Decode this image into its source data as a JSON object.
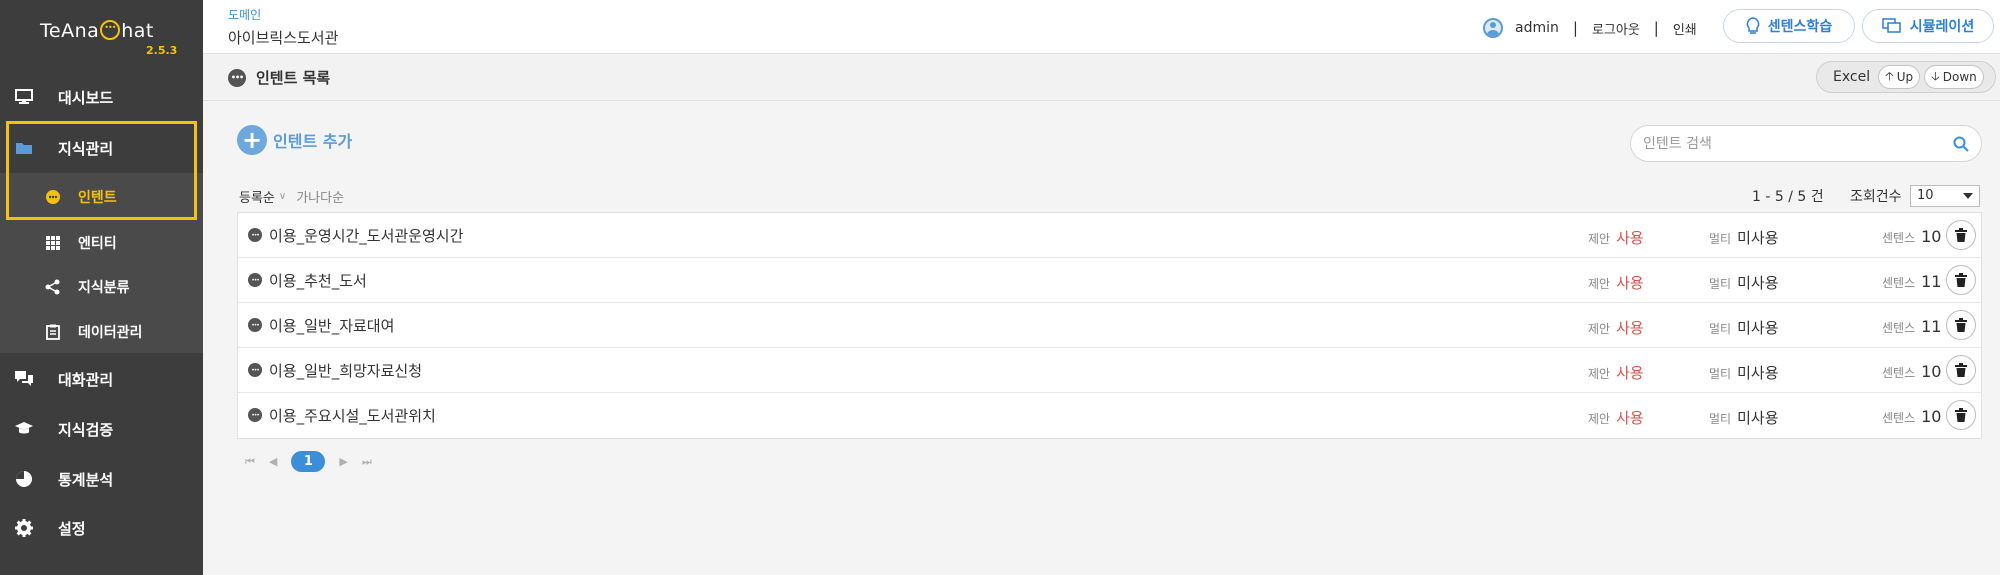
{
  "app": {
    "logo_text_before": "TeAna",
    "logo_text_after": "hat",
    "version": "2.5.3"
  },
  "sidebar": {
    "items": [
      {
        "label": "대시보드",
        "icon": "monitor-icon"
      },
      {
        "label": "지식관리",
        "icon": "folder-icon"
      },
      {
        "label": "대화관리",
        "icon": "chat-bubbles-icon"
      },
      {
        "label": "지식검증",
        "icon": "graduation-cap-icon"
      },
      {
        "label": "통계분석",
        "icon": "pie-chart-icon"
      },
      {
        "label": "설정",
        "icon": "gear-icon"
      }
    ],
    "sub_items": [
      {
        "label": "인텐트",
        "icon": "chat-bubble-icon",
        "active": true
      },
      {
        "label": "엔티티",
        "icon": "grid-icon"
      },
      {
        "label": "지식분류",
        "icon": "share-icon"
      },
      {
        "label": "데이터관리",
        "icon": "clipboard-icon"
      }
    ],
    "highlight_color": "#f4c20d"
  },
  "header": {
    "domain_label": "도메인",
    "domain_name": "아이브릭스도서관",
    "user": "admin",
    "logout": "로그아웃",
    "print": "인쇄",
    "sentence_learn": "센텐스학습",
    "simulation": "시뮬레이션"
  },
  "titlebar": {
    "title": "인텐트 목록",
    "excel": "Excel",
    "up": "Up",
    "down": "Down"
  },
  "content": {
    "add_intent": "인텐트 추가",
    "search_placeholder": "인텐트 검색",
    "sort_registered": "등록순",
    "sort_alpha": "가나다순",
    "count": "1 - 5 / 5 건",
    "perpage_label": "조회건수",
    "perpage_value": "10"
  },
  "intents": [
    {
      "name": "이용_운영시간_도서관운영시간",
      "suggest_label": "제안",
      "suggest": "사용",
      "multi_label": "멀티",
      "multi": "미사용",
      "sentence_label": "센텐스",
      "sentences": "10"
    },
    {
      "name": "이용_추천_도서",
      "suggest_label": "제안",
      "suggest": "사용",
      "multi_label": "멀티",
      "multi": "미사용",
      "sentence_label": "센텐스",
      "sentences": "11"
    },
    {
      "name": "이용_일반_자료대여",
      "suggest_label": "제안",
      "suggest": "사용",
      "multi_label": "멀티",
      "multi": "미사용",
      "sentence_label": "센텐스",
      "sentences": "11"
    },
    {
      "name": "이용_일반_희망자료신청",
      "suggest_label": "제안",
      "suggest": "사용",
      "multi_label": "멀티",
      "multi": "미사용",
      "sentence_label": "센텐스",
      "sentences": "10"
    },
    {
      "name": "이용_주요시설_도서관위치",
      "suggest_label": "제안",
      "suggest": "사용",
      "multi_label": "멀티",
      "multi": "미사용",
      "sentence_label": "센텐스",
      "sentences": "10"
    }
  ],
  "pagination": {
    "current": "1"
  },
  "colors": {
    "sidebar_bg": "#3d3d3d",
    "accent_blue": "#3a8fd8",
    "suggest_red": "#d9534f"
  }
}
